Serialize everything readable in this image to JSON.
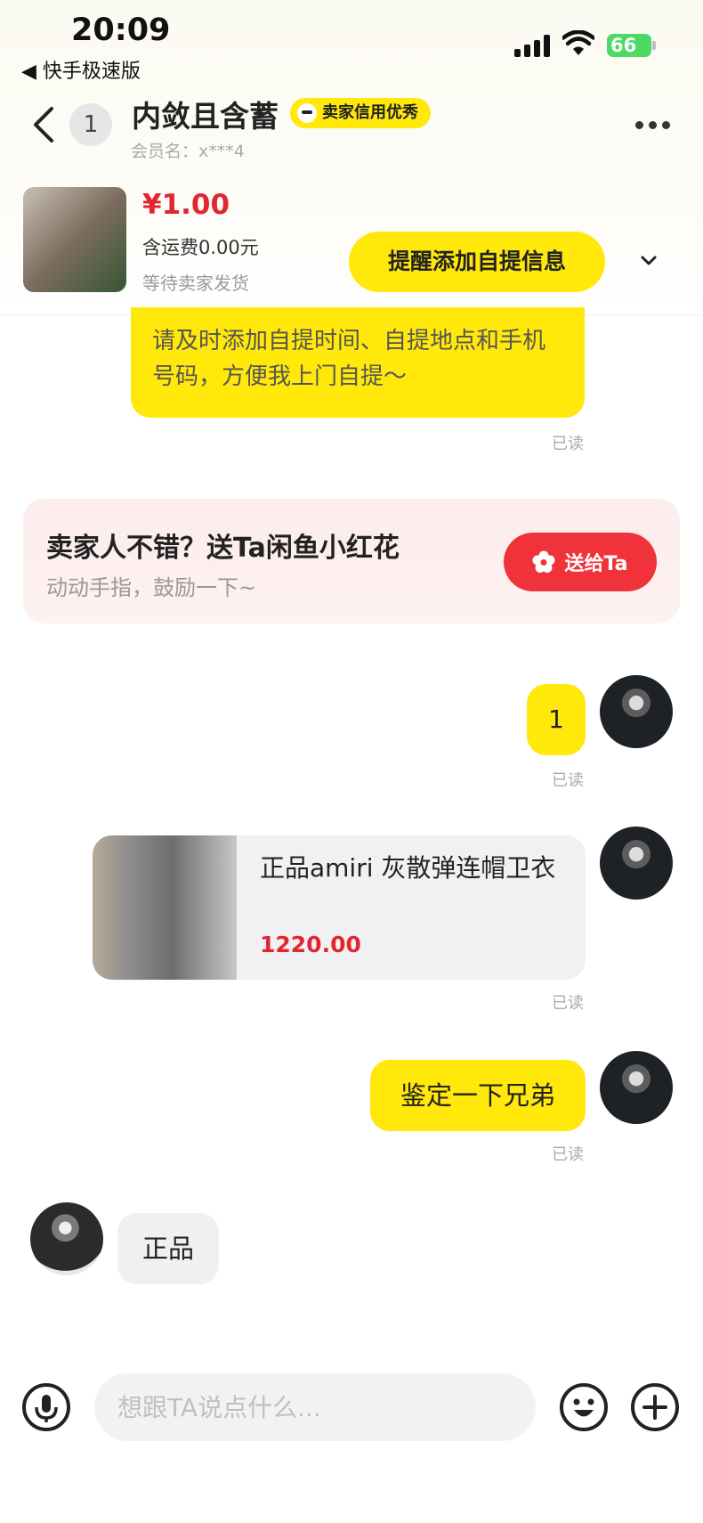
{
  "status_bar": {
    "time": "20:09",
    "back_app": "◀ 快手极速版",
    "battery": "66"
  },
  "header": {
    "unread_count": "1",
    "seller_name": "内敛且含蓄",
    "badge_label": "卖家信用优秀",
    "member_label": "会员名：x***4"
  },
  "order": {
    "price": "¥1.00",
    "shipping": "含运费0.00元",
    "status": "等待卖家发货",
    "remind_button": "提醒添加自提信息"
  },
  "messages": {
    "pickup_request": "请及时添加自提时间、自提地点和手机号码，方便我上门自提～",
    "read_label": "已读",
    "msg_one": "1",
    "product_title": "正品amiri 灰散弹连帽卫衣",
    "product_price": "1220.00",
    "appraise": "鉴定一下兄弟",
    "reply_genuine": "正品"
  },
  "promo": {
    "title": "卖家人不错？送Ta闲鱼小红花",
    "subtitle": "动动手指，鼓励一下~",
    "button": "送给Ta"
  },
  "input_bar": {
    "placeholder": "想跟TA说点什么..."
  },
  "colors": {
    "accent_yellow": "#ffe80a",
    "price_red": "#e2262d",
    "gift_red": "#f0323b"
  },
  "icons": [
    "back-arrow-icon",
    "more-icon",
    "chevron-down-icon",
    "flower-icon",
    "microphone-icon",
    "emoji-icon",
    "plus-icon",
    "signal-icon",
    "wifi-icon",
    "battery-icon"
  ]
}
